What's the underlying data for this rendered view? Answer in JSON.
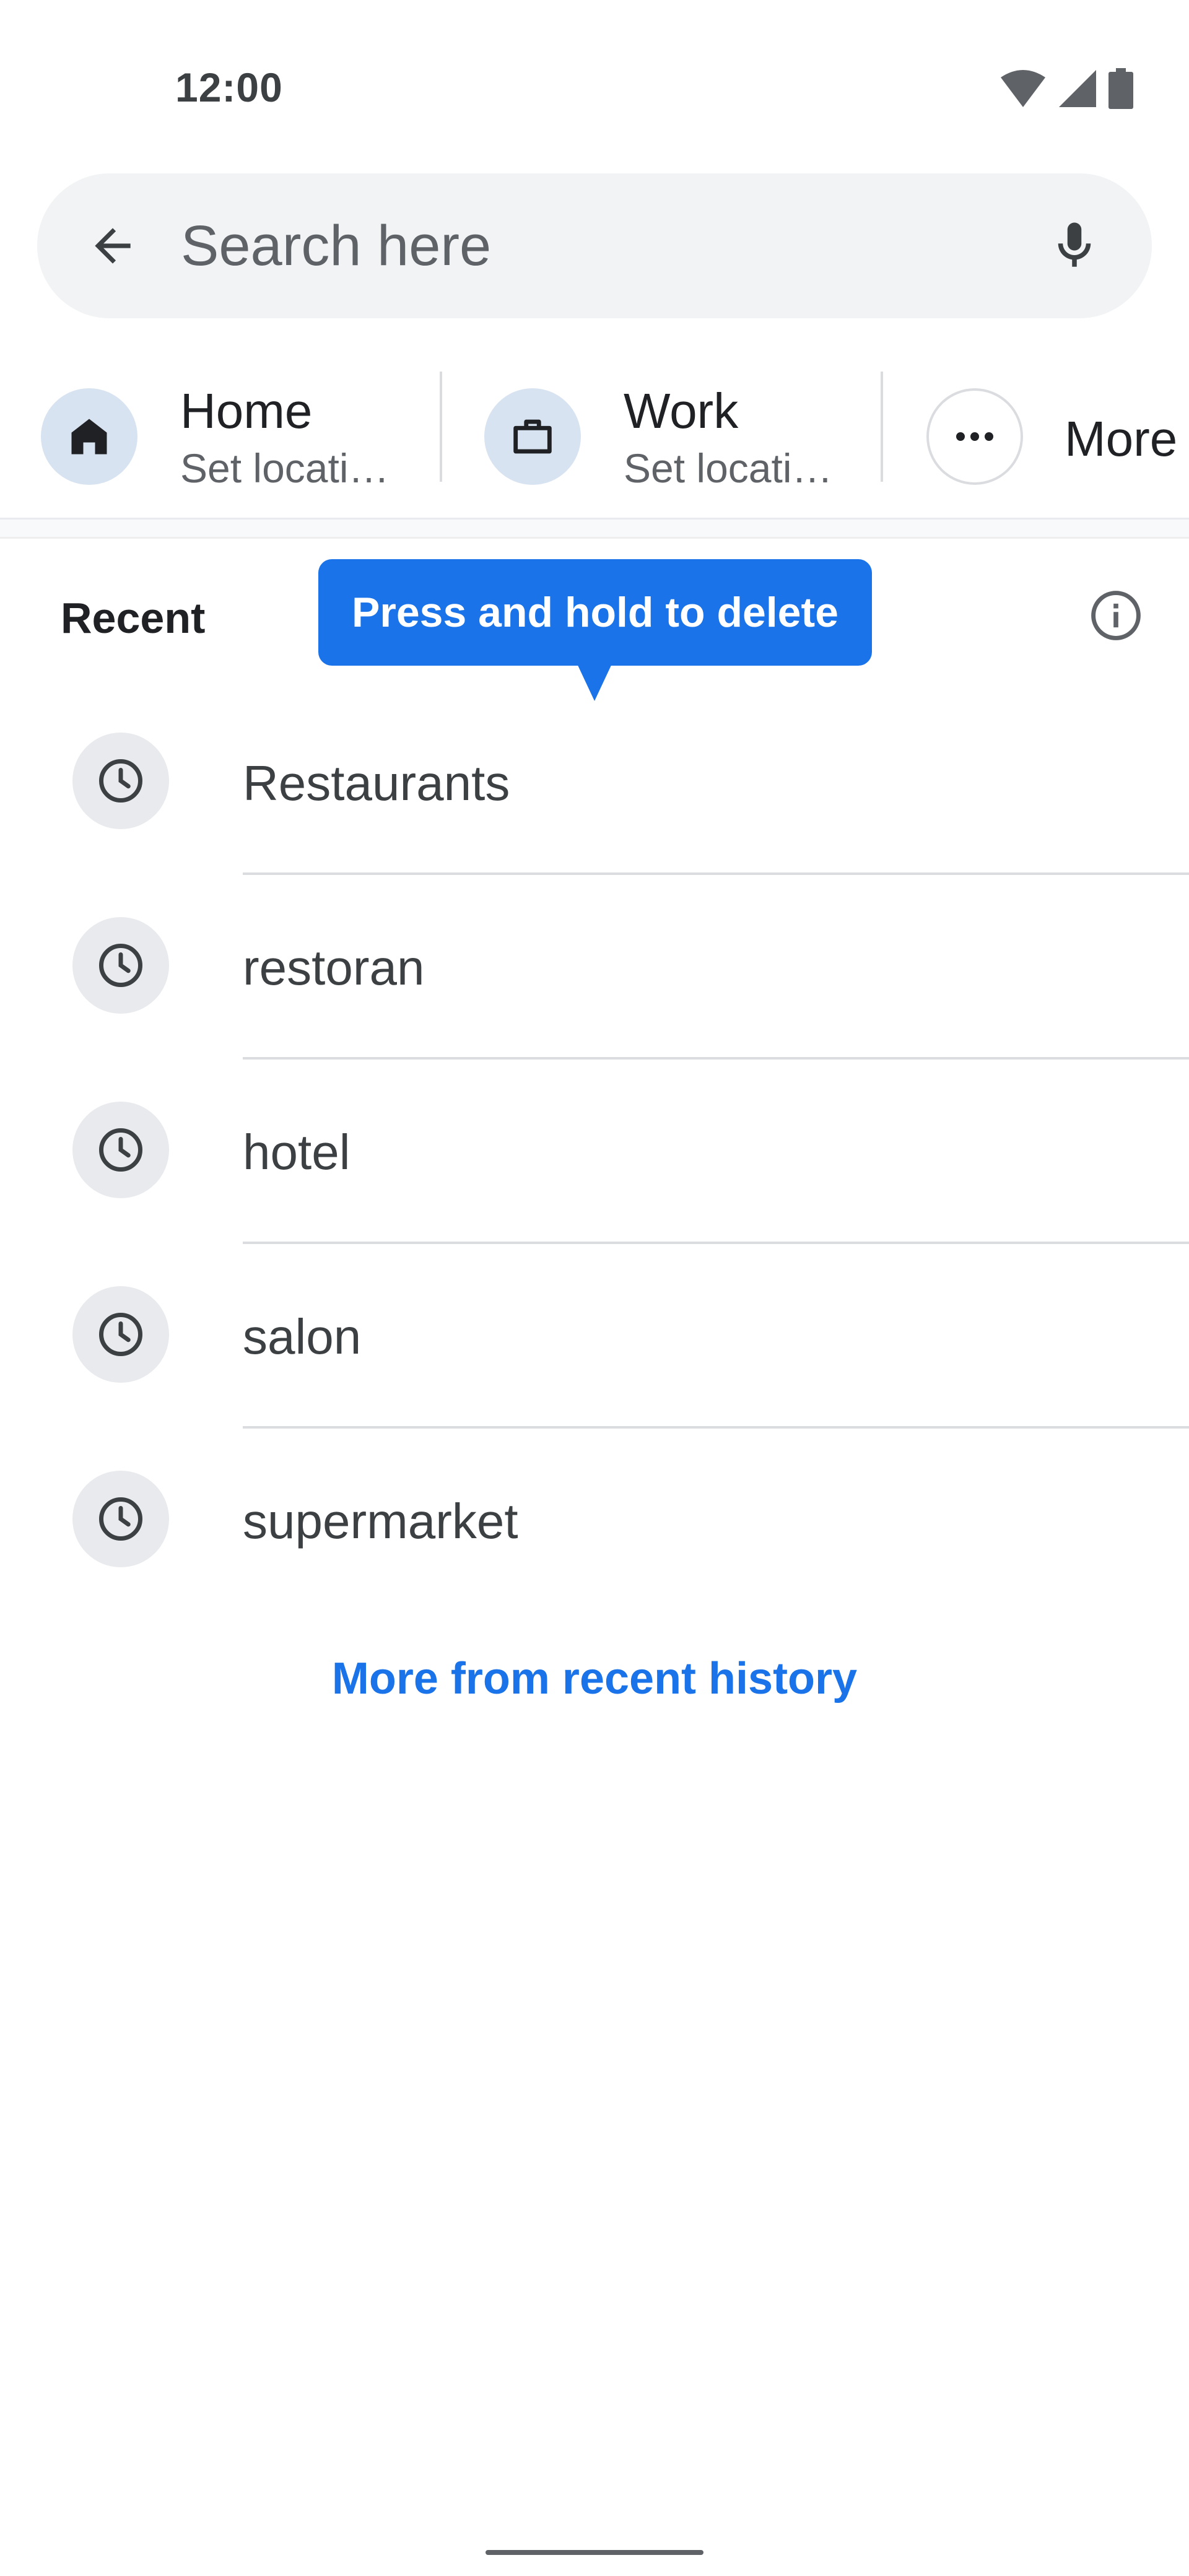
{
  "status_bar": {
    "time": "12:00",
    "icons": [
      "wifi-icon",
      "signal-icon",
      "battery-icon"
    ]
  },
  "search": {
    "placeholder": "Search here",
    "value": "",
    "back_icon": "arrow-back-icon",
    "mic_icon": "microphone-icon"
  },
  "shortcuts": [
    {
      "title": "Home",
      "subtitle": "Set locati…",
      "icon": "home-icon"
    },
    {
      "title": "Work",
      "subtitle": "Set locati…",
      "icon": "briefcase-icon"
    },
    {
      "title": "More",
      "icon": "more-horiz-icon"
    }
  ],
  "recent": {
    "title": "Recent",
    "info_icon": "info-icon",
    "tooltip": "Press and hold to delete",
    "items": [
      {
        "label": "Restaurants",
        "icon": "history-clock-icon"
      },
      {
        "label": "restoran",
        "icon": "history-clock-icon"
      },
      {
        "label": "hotel",
        "icon": "history-clock-icon"
      },
      {
        "label": "salon",
        "icon": "history-clock-icon"
      },
      {
        "label": "supermarket",
        "icon": "history-clock-icon"
      }
    ],
    "more_link": "More from recent history"
  },
  "colors": {
    "accent": "#1a73e8",
    "search_bg": "#f1f3f4",
    "shortcut_circle": "#d7e3f1",
    "clock_circle": "#e8eaed"
  }
}
